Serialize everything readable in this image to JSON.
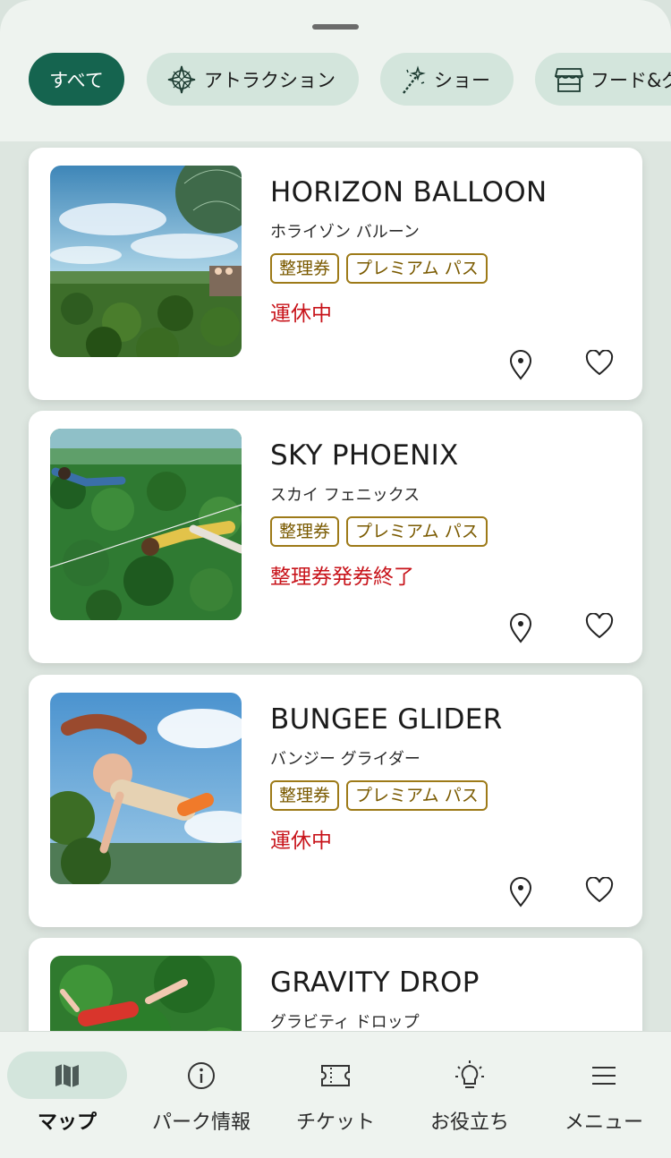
{
  "filters": {
    "chips": [
      {
        "label": "すべて",
        "icon": "",
        "active": true
      },
      {
        "label": "アトラクション",
        "icon": "compass-icon",
        "active": false
      },
      {
        "label": "ショー",
        "icon": "sparkle-wand-icon",
        "active": false
      },
      {
        "label": "フード&グ",
        "icon": "storefront-icon",
        "active": false
      }
    ]
  },
  "attractions": [
    {
      "title": "HORIZON BALLOON",
      "subtitle": "ホライゾン バルーン",
      "tags": [
        "整理券",
        "プレミアム パス"
      ],
      "status": "運休中",
      "image": "hot-air-balloon-over-forest"
    },
    {
      "title": "SKY PHOENIX",
      "subtitle": "スカイ フェニックス",
      "tags": [
        "整理券",
        "プレミアム パス"
      ],
      "status": "整理券発券終了",
      "image": "zipline-riders-over-forest"
    },
    {
      "title": "BUNGEE GLIDER",
      "subtitle": "バンジー グライダー",
      "tags": [
        "整理券",
        "プレミアム パス"
      ],
      "status": "運休中",
      "image": "woman-flying-over-jungle"
    },
    {
      "title": "GRAVITY DROP",
      "subtitle": "グラビティ ドロップ",
      "tags": [],
      "status": "",
      "image": "person-falling-into-forest"
    }
  ],
  "bottom_nav": [
    {
      "label": "マップ",
      "icon": "map-icon",
      "active": true
    },
    {
      "label": "パーク情報",
      "icon": "info-icon",
      "active": false
    },
    {
      "label": "チケット",
      "icon": "ticket-icon",
      "active": false
    },
    {
      "label": "お役立ち",
      "icon": "lightbulb-icon",
      "active": false
    },
    {
      "label": "メニュー",
      "icon": "menu-icon",
      "active": false
    }
  ],
  "colors": {
    "accent": "#15644f",
    "chip_bg": "#d3e5dc",
    "status_red": "#c8141b",
    "tag_gold": "#9d7a18"
  }
}
